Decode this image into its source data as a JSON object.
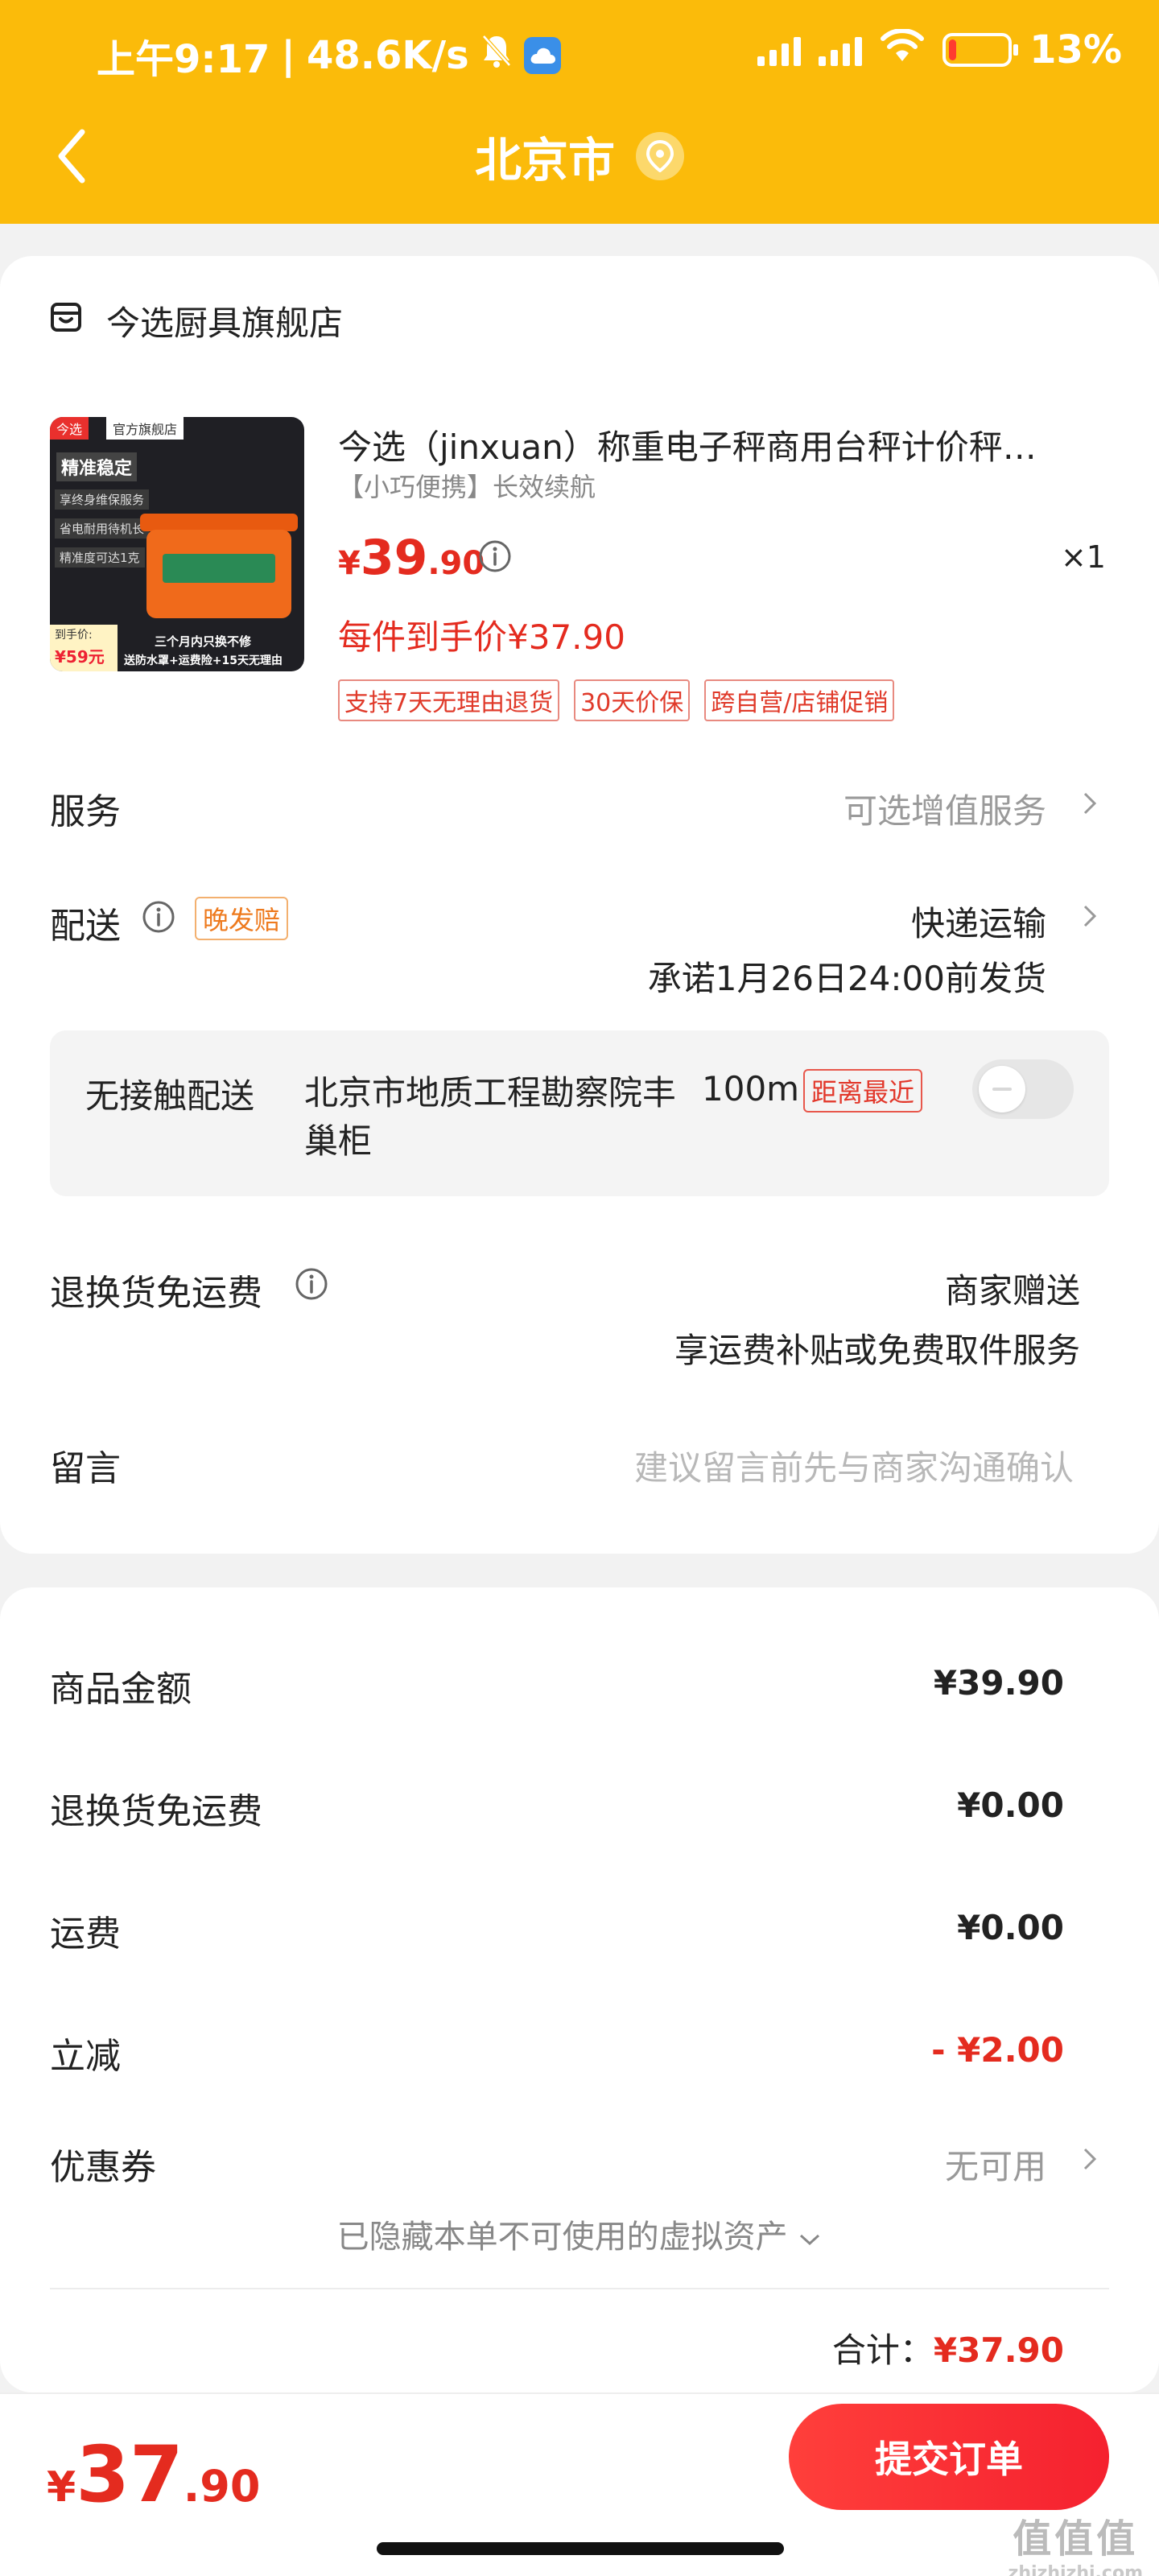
{
  "status_bar": {
    "time": "上午9:17",
    "separator": "|",
    "net_speed": "48.6K/s",
    "battery": "13%",
    "battery_level": 0.13
  },
  "nav": {
    "title": "北京市"
  },
  "store": {
    "name": "今选厨具旗舰店"
  },
  "product": {
    "title": "今选（jinxuan）称重电子秤商用台秤计价秤…",
    "subtitle": "【小巧便携】长效续航",
    "price_currency": "¥",
    "price_int": "39",
    "price_dec": ".90",
    "quantity": "×1",
    "each_price": "每件到手价¥37.90",
    "tags": [
      "支持7天无理由退货",
      "30天价保",
      "跨自营/店铺促销"
    ],
    "image": {
      "tag_brand": "今选",
      "tag_store": "官方旗舰店",
      "headline": "精准稳定",
      "features": [
        "享终身维保服务",
        "省电耐用待机长",
        "精准度可达1克"
      ],
      "promo_line1": "三个月内只换不修",
      "promo_line2": "送防水罩+运费险+15天无理由",
      "price_label": "到手价:",
      "price_value": "¥59元"
    }
  },
  "service": {
    "label": "服务",
    "value": "可选增值服务"
  },
  "delivery": {
    "label": "配送",
    "badge": "晚发赔",
    "method": "快递运输",
    "promise": "承诺1月26日24:00前发货"
  },
  "contactless": {
    "label": "无接触配送",
    "place": "北京市地质工程勘察院丰巢柜",
    "distance": "100m",
    "badge": "距离最近"
  },
  "return_shipping": {
    "label": "退换货免运费",
    "value": "商家赠送",
    "desc": "享运费补贴或免费取件服务"
  },
  "message": {
    "label": "留言",
    "placeholder": "建议留言前先与商家沟通确认"
  },
  "summary": {
    "rows": [
      {
        "label": "商品金额",
        "value": "¥39.90"
      },
      {
        "label": "退换货免运费",
        "value": "¥0.00"
      },
      {
        "label": "运费",
        "value": "¥0.00"
      },
      {
        "label": "立减",
        "value": "- ¥2.00"
      },
      {
        "label": "优惠券",
        "value": "无可用"
      }
    ],
    "hidden_assets": "已隐藏本单不可使用的虚拟资产",
    "total_label": "合计：",
    "total_value": "¥37.90"
  },
  "bottom": {
    "price_currency": "¥",
    "price_int": "37",
    "price_dec": ".90",
    "submit_label": "提交订单"
  },
  "watermark": {
    "text": "值值值",
    "url": "zhizhizhi.com"
  },
  "colors": {
    "header": "#fbbb0a",
    "accent_red": "#e42b1f",
    "submit_button": "#f5212f"
  }
}
